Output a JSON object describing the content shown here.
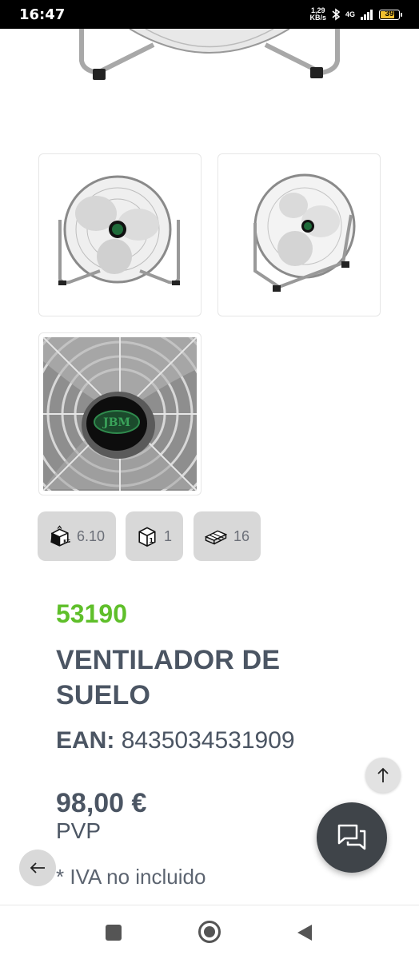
{
  "status_bar": {
    "time": "16:47",
    "net_speed_value": "1,29",
    "net_speed_unit": "KB/s",
    "network": "4G",
    "battery": "39"
  },
  "chips": [
    {
      "icon": "weight-kg-icon",
      "value": "6.10"
    },
    {
      "icon": "box-units-icon",
      "value": "1"
    },
    {
      "icon": "pallet-icon",
      "value": "16"
    }
  ],
  "product": {
    "reference": "53190",
    "title": "VENTILADOR DE SUELO",
    "ean_label": "EAN:",
    "ean_value": "8435034531909",
    "price": "98,00 €",
    "price_type": "PVP",
    "tax_note": "* IVA no incluido"
  },
  "thumb_logo": "JBM",
  "colors": {
    "reference_green": "#5fbf2a",
    "text_dark": "#4b5563",
    "chip_bg": "#d8d8d8",
    "chat_button": "#3f4449"
  }
}
